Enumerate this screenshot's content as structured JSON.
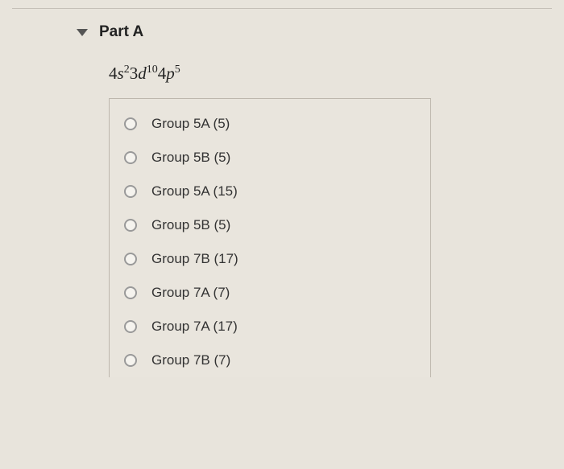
{
  "header": {
    "part_label": "Part A"
  },
  "question": {
    "config_base1": "4",
    "config_orb1": "s",
    "config_sup1": "2",
    "config_base2": "3",
    "config_orb2": "d",
    "config_sup2": "10",
    "config_base3": "4",
    "config_orb3": "p",
    "config_sup3": "5"
  },
  "options": [
    {
      "label": "Group 5A (5)"
    },
    {
      "label": "Group 5B (5)"
    },
    {
      "label": "Group 5A (15)"
    },
    {
      "label": "Group 5B (5)"
    },
    {
      "label": "Group 7B (17)"
    },
    {
      "label": "Group 7A (7)"
    },
    {
      "label": "Group 7A (17)"
    },
    {
      "label": "Group 7B (7)"
    }
  ]
}
